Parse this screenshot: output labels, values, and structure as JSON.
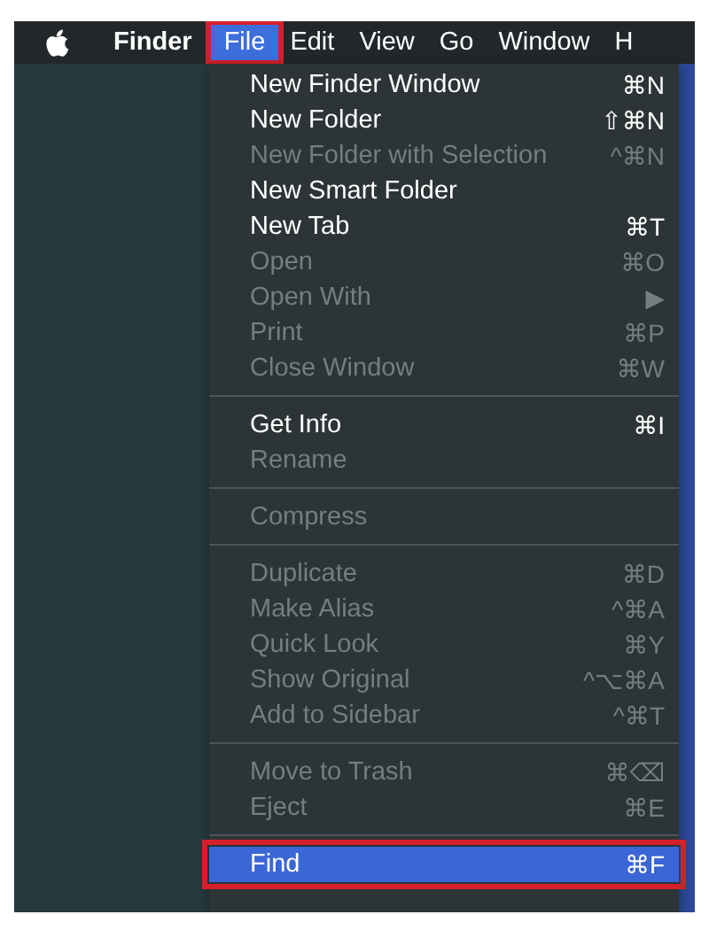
{
  "menu_bar": {
    "app_name": "Finder",
    "menus": [
      {
        "label": "File",
        "selected": true,
        "outlined": true
      },
      {
        "label": "Edit",
        "selected": false,
        "outlined": false
      },
      {
        "label": "View",
        "selected": false,
        "outlined": false
      },
      {
        "label": "Go",
        "selected": false,
        "outlined": false
      },
      {
        "label": "Window",
        "selected": false,
        "outlined": false
      },
      {
        "label": "H",
        "selected": false,
        "outlined": false
      }
    ]
  },
  "file_menu": {
    "items": [
      {
        "kind": "item",
        "label": "New Finder Window",
        "shortcut": "⌘N",
        "disabled": false,
        "selected": false,
        "outlined": false
      },
      {
        "kind": "item",
        "label": "New Folder",
        "shortcut": "⇧⌘N",
        "disabled": false,
        "selected": false,
        "outlined": false
      },
      {
        "kind": "item",
        "label": "New Folder with Selection",
        "shortcut": "^⌘N",
        "disabled": true,
        "selected": false,
        "outlined": false
      },
      {
        "kind": "item",
        "label": "New Smart Folder",
        "disabled": false,
        "selected": false,
        "outlined": false
      },
      {
        "kind": "item",
        "label": "New Tab",
        "shortcut": "⌘T",
        "disabled": false,
        "selected": false,
        "outlined": false
      },
      {
        "kind": "item",
        "label": "Open",
        "shortcut": "⌘O",
        "disabled": true,
        "selected": false,
        "outlined": false
      },
      {
        "kind": "item",
        "label": "Open With",
        "shortcut": "▶",
        "disabled": true,
        "selected": false,
        "outlined": false
      },
      {
        "kind": "item",
        "label": "Print",
        "shortcut": "⌘P",
        "disabled": true,
        "selected": false,
        "outlined": false
      },
      {
        "kind": "item",
        "label": "Close Window",
        "shortcut": "⌘W",
        "disabled": true,
        "selected": false,
        "outlined": false
      },
      {
        "kind": "separator"
      },
      {
        "kind": "item",
        "label": "Get Info",
        "shortcut": "⌘I",
        "disabled": false,
        "selected": false,
        "outlined": false
      },
      {
        "kind": "item",
        "label": "Rename",
        "disabled": true,
        "selected": false,
        "outlined": false
      },
      {
        "kind": "separator"
      },
      {
        "kind": "item",
        "label": "Compress",
        "disabled": true,
        "selected": false,
        "outlined": false
      },
      {
        "kind": "separator"
      },
      {
        "kind": "item",
        "label": "Duplicate",
        "shortcut": "⌘D",
        "disabled": true,
        "selected": false,
        "outlined": false
      },
      {
        "kind": "item",
        "label": "Make Alias",
        "shortcut": "^⌘A",
        "disabled": true,
        "selected": false,
        "outlined": false
      },
      {
        "kind": "item",
        "label": "Quick Look",
        "shortcut": "⌘Y",
        "disabled": true,
        "selected": false,
        "outlined": false
      },
      {
        "kind": "item",
        "label": "Show Original",
        "shortcut": "^⌥⌘A",
        "disabled": true,
        "selected": false,
        "outlined": false
      },
      {
        "kind": "item",
        "label": "Add to Sidebar",
        "shortcut": "^⌘T",
        "disabled": true,
        "selected": false,
        "outlined": false
      },
      {
        "kind": "separator"
      },
      {
        "kind": "item",
        "label": "Move to Trash",
        "shortcut": "⌘⌫",
        "disabled": true,
        "selected": false,
        "outlined": false
      },
      {
        "kind": "item",
        "label": "Eject",
        "shortcut": "⌘E",
        "disabled": true,
        "selected": false,
        "outlined": false
      },
      {
        "kind": "separator"
      },
      {
        "kind": "item",
        "label": "Find",
        "shortcut": "⌘F",
        "disabled": false,
        "selected": true,
        "outlined": true
      }
    ]
  }
}
